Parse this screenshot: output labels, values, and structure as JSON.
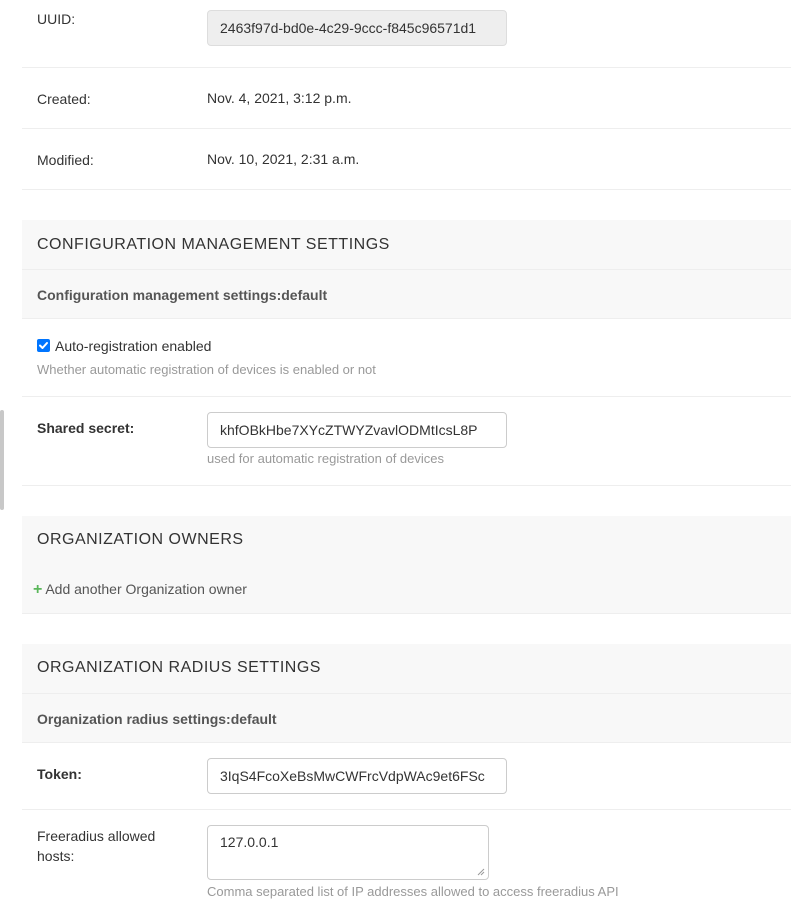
{
  "general": {
    "uuid_label": "UUID:",
    "uuid_value": "2463f97d-bd0e-4c29-9ccc-f845c96571d1",
    "created_label": "Created:",
    "created_value": "Nov. 4, 2021, 3:12 p.m.",
    "modified_label": "Modified:",
    "modified_value": "Nov. 10, 2021, 2:31 a.m."
  },
  "config_section": {
    "title": "CONFIGURATION MANAGEMENT SETTINGS",
    "subtitle": "Configuration management settings:default",
    "auto_registration_label": "Auto-registration enabled",
    "auto_registration_checked": true,
    "auto_registration_help": "Whether automatic registration of devices is enabled or not",
    "shared_secret_label": "Shared secret:",
    "shared_secret_value": "khfOBkHbe7XYcZTWYZvavlODMtIcsL8P",
    "shared_secret_help": "used for automatic registration of devices"
  },
  "owners_section": {
    "title": "ORGANIZATION OWNERS",
    "add_link": "Add another Organization owner"
  },
  "radius_section": {
    "title": "ORGANIZATION RADIUS SETTINGS",
    "subtitle": "Organization radius settings:default",
    "token_label": "Token:",
    "token_value": "3IqS4FcoXeBsMwCWFrcVdpWAc9et6FSc",
    "hosts_label_line1": "Freeradius allowed",
    "hosts_label_line2": "hosts:",
    "hosts_value": "127.0.0.1",
    "hosts_help": "Comma separated list of IP addresses allowed to access freeradius API"
  },
  "icons": {
    "plus": "plus-icon",
    "checkbox": "checkbox-checked-icon",
    "resize": "resize-grip-icon"
  },
  "colors": {
    "checkbox": "#0075ff",
    "plus": "#5bb75b",
    "section_bg": "#f8f8f8",
    "readonly_bg": "#eeeeee"
  }
}
